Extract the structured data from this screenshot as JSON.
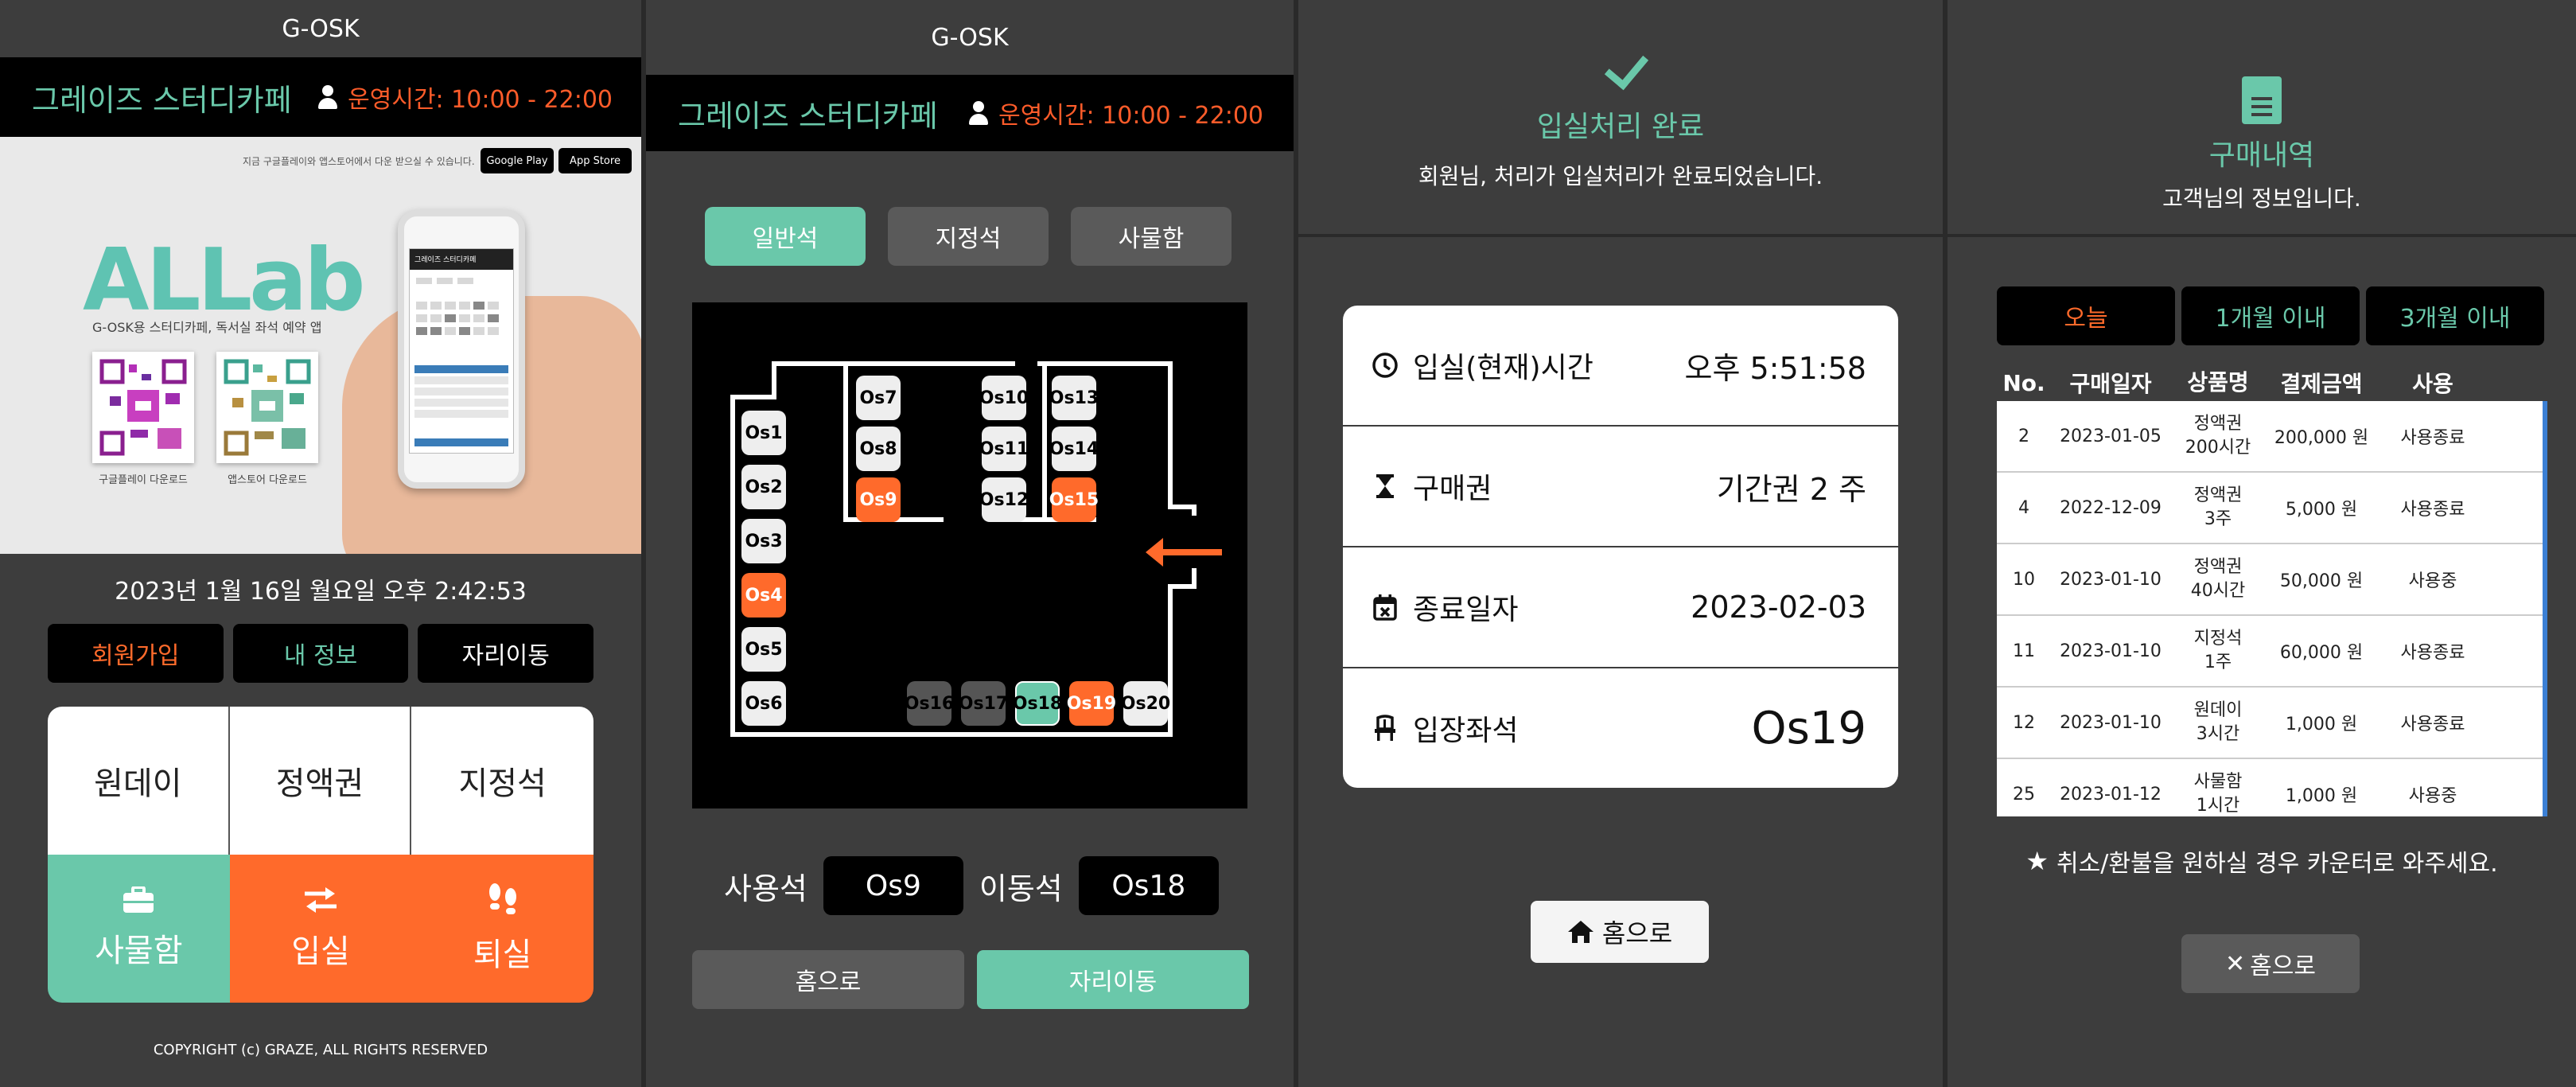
{
  "app_title": "G-OSK",
  "brand": "그레이즈 스터디카페",
  "hours": "운영시간: 10:00 - 22:00",
  "colors": {
    "accent": "#6ac8aa",
    "alert": "#ff6a2b",
    "bar": "#000000",
    "bg": "#3d3d3d"
  },
  "home": {
    "banner": {
      "download_note": "지금 구글플레이와 앱스토어에서 다운 받으실 수 있습니다.",
      "google_play": "Google Play",
      "app_store": "App Store",
      "logo": "ALLab",
      "tagline": "G-OSK용 스터디카페, 독서실 좌석 예약 앱",
      "qr_google_caption": "구글플레이 다운로드",
      "qr_apple_caption": "앱스토어 다운로드"
    },
    "clock": "2023년 1월 16일 월요일 오후 2:42:53",
    "buttons": {
      "signup": "회원가입",
      "my_info": "내 정보",
      "move_seat": "자리이동"
    },
    "menu": {
      "oneday": "원데이",
      "fixed_amount": "정액권",
      "reserved_seat": "지정석",
      "locker": "사물함",
      "check_in": "입실",
      "check_out": "퇴실"
    },
    "copyright": "COPYRIGHT (c) GRAZE, ALL RIGHTS RESERVED"
  },
  "seatmap": {
    "tabs": [
      "일반석",
      "지정석",
      "사물함"
    ],
    "active_tab": "일반석",
    "seats": [
      {
        "id": "Os1",
        "state": "free"
      },
      {
        "id": "Os2",
        "state": "free"
      },
      {
        "id": "Os3",
        "state": "free"
      },
      {
        "id": "Os4",
        "state": "taken"
      },
      {
        "id": "Os5",
        "state": "free"
      },
      {
        "id": "Os6",
        "state": "free"
      },
      {
        "id": "Os7",
        "state": "free"
      },
      {
        "id": "Os8",
        "state": "free"
      },
      {
        "id": "Os9",
        "state": "taken"
      },
      {
        "id": "Os10",
        "state": "free"
      },
      {
        "id": "Os11",
        "state": "free"
      },
      {
        "id": "Os12",
        "state": "free"
      },
      {
        "id": "Os13",
        "state": "free"
      },
      {
        "id": "Os14",
        "state": "free"
      },
      {
        "id": "Os15",
        "state": "taken"
      },
      {
        "id": "Os16",
        "state": "gray"
      },
      {
        "id": "Os17",
        "state": "gray"
      },
      {
        "id": "Os18",
        "state": "selected"
      },
      {
        "id": "Os19",
        "state": "taken"
      },
      {
        "id": "Os20",
        "state": "free"
      }
    ],
    "current_label": "사용석",
    "current_seat": "Os9",
    "move_label": "이동석",
    "move_seat": "Os18",
    "btn_home": "홈으로",
    "btn_move": "자리이동"
  },
  "checkin": {
    "title": "입실처리 완료",
    "subtitle": "회원님, 처리가 입실처리가 완료되었습니다.",
    "rows": [
      {
        "label": "입실(현재)시간",
        "value": "오후 5:51:58",
        "icon": "clock-icon"
      },
      {
        "label": "구매권",
        "value": "기간권 2 주",
        "icon": "hourglass-icon"
      },
      {
        "label": "종료일자",
        "value": "2023-02-03",
        "icon": "calendar-icon"
      },
      {
        "label": "입장좌석",
        "value": "Os19",
        "icon": "chair-icon"
      }
    ],
    "home_btn": "홈으로"
  },
  "history": {
    "title": "구매내역",
    "subtitle": "고객님의 정보입니다.",
    "periods": [
      "오늘",
      "1개월 이내",
      "3개월 이내"
    ],
    "active_period": "오늘",
    "columns": [
      "No.",
      "구매일자",
      "상품명",
      "결제금액",
      "사용"
    ],
    "rows": [
      {
        "no": "2",
        "date": "2023-01-05",
        "product": [
          "정액권",
          "200시간"
        ],
        "amount": "200,000 원",
        "status": "사용종료"
      },
      {
        "no": "4",
        "date": "2022-12-09",
        "product": [
          "정액권",
          "3주"
        ],
        "amount": "5,000 원",
        "status": "사용종료"
      },
      {
        "no": "10",
        "date": "2023-01-10",
        "product": [
          "정액권",
          "40시간"
        ],
        "amount": "50,000 원",
        "status": "사용중"
      },
      {
        "no": "11",
        "date": "2023-01-10",
        "product": [
          "지정석",
          "1주"
        ],
        "amount": "60,000 원",
        "status": "사용종료"
      },
      {
        "no": "12",
        "date": "2023-01-10",
        "product": [
          "원데이",
          "3시간"
        ],
        "amount": "1,000 원",
        "status": "사용종료"
      },
      {
        "no": "25",
        "date": "2023-01-12",
        "product": [
          "사물함",
          "1시간"
        ],
        "amount": "1,000 원",
        "status": "사용중"
      }
    ],
    "notice": "취소/환불을 원하실 경우 카운터로 와주세요.",
    "home_btn": "홈으로"
  }
}
